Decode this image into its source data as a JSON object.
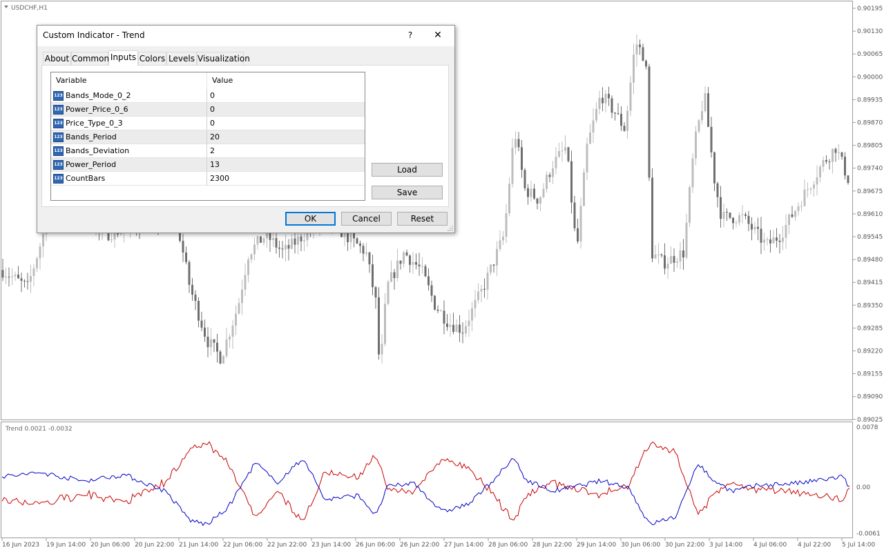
{
  "chart_window": {
    "symbol_label": "USDCHF,H1",
    "indicator_label": "Trend 0.0021 -0.0032",
    "price_axis": [
      "0.90195",
      "0.90130",
      "0.90065",
      "0.90000",
      "0.89935",
      "0.89870",
      "0.89805",
      "0.89740",
      "0.89675",
      "0.89610",
      "0.89545",
      "0.89480",
      "0.89415",
      "0.89350",
      "0.89285",
      "0.89220",
      "0.89155",
      "0.89090",
      "0.89025"
    ],
    "indicator_axis": [
      "0.0078",
      "0.00",
      "-0.0061"
    ],
    "time_axis": [
      "16 Jun 2023",
      "19 Jun 14:00",
      "20 Jun 06:00",
      "20 Jun 22:00",
      "21 Jun 14:00",
      "22 Jun 06:00",
      "22 Jun 22:00",
      "23 Jun 14:00",
      "26 Jun 06:00",
      "26 Jun 22:00",
      "27 Jun 14:00",
      "28 Jun 06:00",
      "28 Jun 22:00",
      "29 Jun 14:00",
      "30 Jun 06:00",
      "30 Jun 22:00",
      "3 Jul 14:00",
      "4 Jul 06:00",
      "4 Jul 22:00",
      "5 Jul 14:00"
    ],
    "colors": {
      "bull": "#bdbdbd",
      "bear": "#6e6e6e",
      "line_blue": "#0000c8",
      "line_red": "#c80000"
    }
  },
  "dialog": {
    "title": "Custom Indicator - Trend",
    "help_label": "?",
    "close_label": "✕",
    "tabs": [
      "About",
      "Common",
      "Inputs",
      "Colors",
      "Levels",
      "Visualization"
    ],
    "active_tab": "Inputs",
    "table_headers": {
      "variable": "Variable",
      "value": "Value"
    },
    "inputs": [
      {
        "name": "Bands_Mode_0_2",
        "value": "0"
      },
      {
        "name": "Power_Price_0_6",
        "value": "0"
      },
      {
        "name": "Price_Type_0_3",
        "value": "0"
      },
      {
        "name": "Bands_Period",
        "value": "20"
      },
      {
        "name": "Bands_Deviation",
        "value": "2"
      },
      {
        "name": "Power_Period",
        "value": "13"
      },
      {
        "name": "CountBars",
        "value": "2300"
      }
    ],
    "icon_glyph": "123",
    "buttons": {
      "load": "Load",
      "save": "Save",
      "ok": "OK",
      "cancel": "Cancel",
      "reset": "Reset"
    }
  }
}
